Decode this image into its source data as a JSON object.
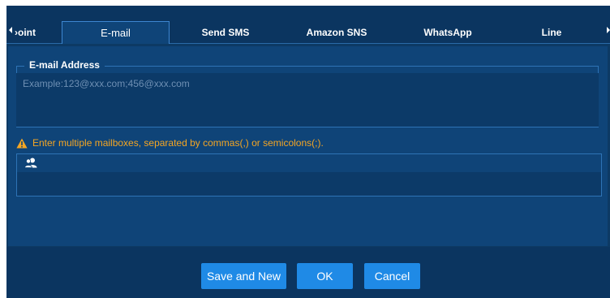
{
  "tabs": [
    {
      "label": "›oint"
    },
    {
      "label": "E-mail",
      "active": true
    },
    {
      "label": "Send SMS"
    },
    {
      "label": "Amazon SNS"
    },
    {
      "label": "WhatsApp"
    },
    {
      "label": "Line"
    }
  ],
  "email_section": {
    "legend": "E-mail Address",
    "placeholder": "Example:123@xxx.com;456@xxx.com",
    "value": ""
  },
  "hint": {
    "icon": "warning-icon",
    "text": "Enter multiple mailboxes, separated by commas(,) or semicolons(;)."
  },
  "contacts": {
    "icon": "contacts-group-icon"
  },
  "buttons": {
    "save_new": "Save and New",
    "ok": "OK",
    "cancel": "Cancel"
  },
  "colors": {
    "background": "#0d3a64",
    "accent": "#1f8ae6",
    "warning": "#f5a623"
  }
}
